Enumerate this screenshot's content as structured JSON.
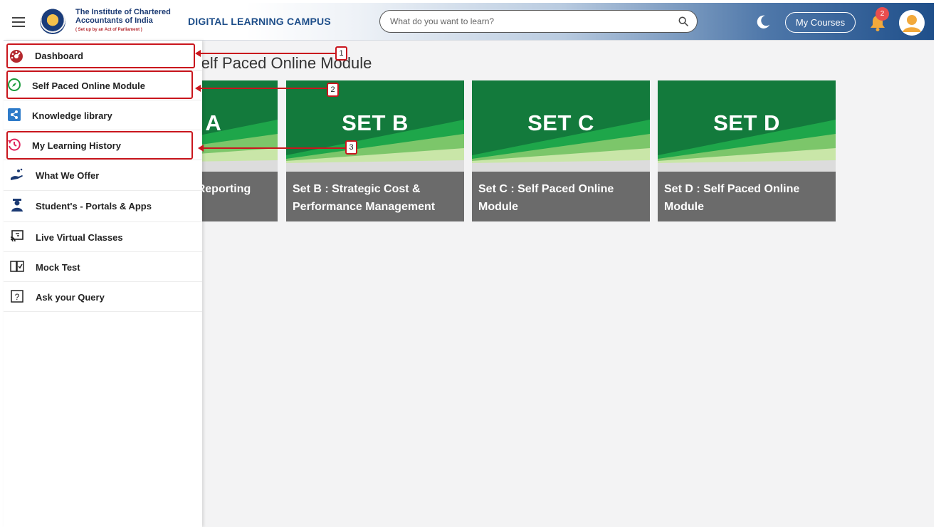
{
  "header": {
    "org_line1": "The Institute of Chartered",
    "org_line2": "Accountants of India",
    "org_line3": "( Set up by an Act of Parliament )",
    "brand_title": "DIGITAL LEARNING CAMPUS",
    "search_placeholder": "What do you want to learn?",
    "my_courses_label": "My Courses",
    "notification_count": "2"
  },
  "page": {
    "title": "Self Paced Online Module"
  },
  "cards": [
    {
      "set_label": "SET A",
      "caption": "Set A : Financial Reporting and"
    },
    {
      "set_label": "SET B",
      "caption": "Set B : Strategic Cost & Performance Management"
    },
    {
      "set_label": "SET C",
      "caption": "Set C : Self Paced Online Module"
    },
    {
      "set_label": "SET D",
      "caption": "Set D : Self Paced Online Module"
    }
  ],
  "sidebar": {
    "items": [
      {
        "label": "Dashboard",
        "icon": "dashboard-gauge-icon"
      },
      {
        "label": "Self Paced Online Module",
        "icon": "compass-icon"
      },
      {
        "label": "Knowledge library",
        "icon": "share-icon"
      },
      {
        "label": "My Learning History",
        "icon": "history-icon"
      },
      {
        "label": "What We Offer",
        "icon": "hand-offer-icon"
      },
      {
        "label": "Student's - Portals & Apps",
        "icon": "student-icon"
      },
      {
        "label": "Live Virtual Classes",
        "icon": "cast-icon"
      },
      {
        "label": "Mock Test",
        "icon": "book-check-icon"
      },
      {
        "label": "Ask your Query",
        "icon": "question-box-icon"
      }
    ]
  },
  "annotations": [
    "1",
    "2",
    "3"
  ],
  "colors": {
    "brand_blue": "#1f4f8a",
    "card_green": "#137a3c",
    "card_caption_bg": "#6b6b6b",
    "highlight_red": "#c9161d",
    "badge_red": "#e94e4e"
  }
}
